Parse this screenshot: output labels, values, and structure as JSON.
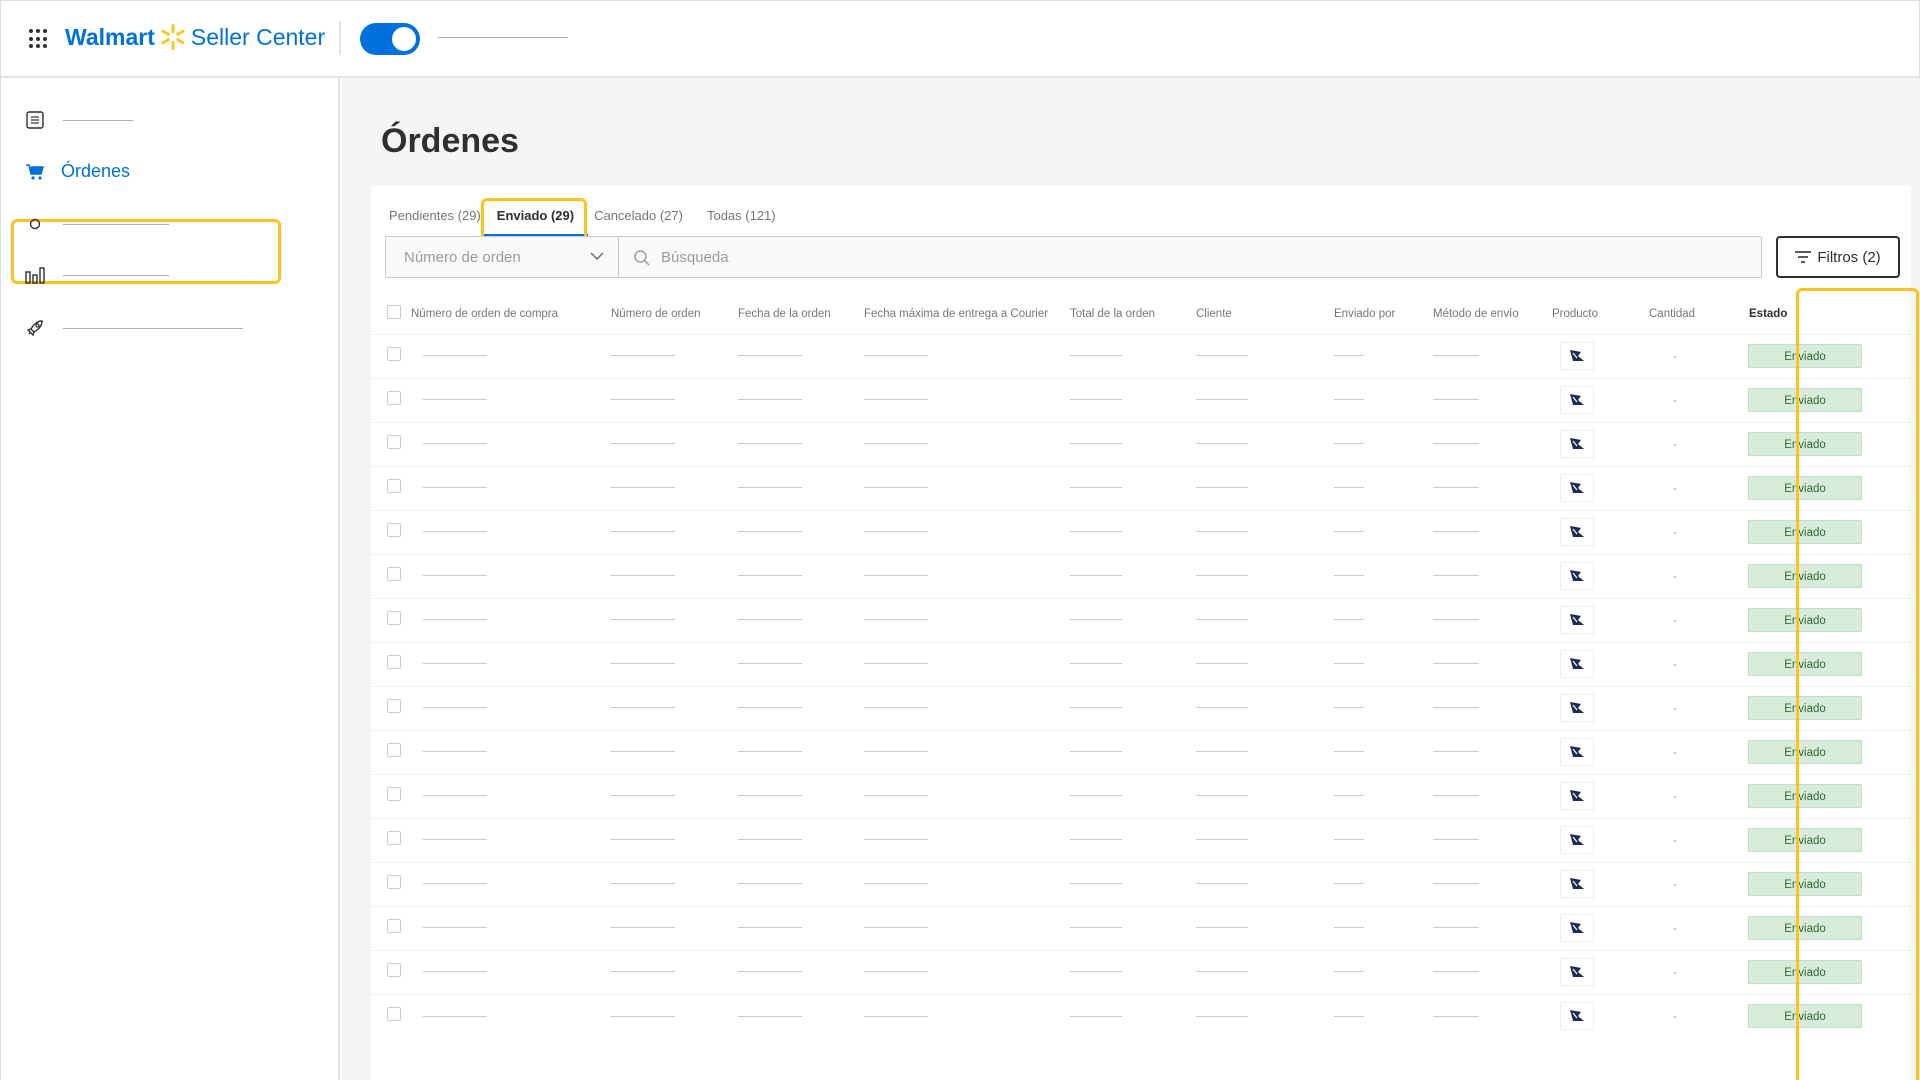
{
  "header": {
    "brand_name": "Walmart",
    "brand_product": "Seller Center"
  },
  "sidebar": {
    "active_label": "Órdenes"
  },
  "main": {
    "title": "Órdenes",
    "tabs": [
      {
        "label": "Pendientes (29)"
      },
      {
        "label": "Enviado (29)"
      },
      {
        "label": "Cancelado (27)"
      },
      {
        "label": "Todas (121)"
      }
    ],
    "search": {
      "select_placeholder": "Número de orden",
      "search_placeholder": "Búsqueda",
      "filter_label": "Filtros (2)"
    },
    "table": {
      "columns": [
        "Número de orden de compra",
        "Número de orden",
        "Fecha de la orden",
        "Fecha máxima de entrega a Courier",
        "Total de la orden",
        "Cliente",
        "Enviado por",
        "Método de envío",
        "Producto",
        "Cantidad",
        "Estado"
      ],
      "rows": [
        {
          "quantity": "-",
          "status": "Enviado"
        },
        {
          "quantity": "-",
          "status": "Enviado"
        },
        {
          "quantity": "-",
          "status": "Enviado"
        },
        {
          "quantity": "-",
          "status": "Enviado"
        },
        {
          "quantity": "-",
          "status": "Enviado"
        },
        {
          "quantity": "-",
          "status": "Enviado"
        },
        {
          "quantity": "-",
          "status": "Enviado"
        },
        {
          "quantity": "-",
          "status": "Enviado"
        },
        {
          "quantity": "-",
          "status": "Enviado"
        },
        {
          "quantity": "-",
          "status": "Enviado"
        },
        {
          "quantity": "-",
          "status": "Enviado"
        },
        {
          "quantity": "-",
          "status": "Enviado"
        },
        {
          "quantity": "-",
          "status": "Enviado"
        },
        {
          "quantity": "-",
          "status": "Enviado"
        },
        {
          "quantity": "-",
          "status": "Enviado"
        },
        {
          "quantity": "-",
          "status": "Enviado"
        }
      ]
    }
  },
  "colors": {
    "brand_blue": "#0071dc",
    "highlight_yellow": "#ffc220",
    "status_green_bg": "#d7ecd9"
  }
}
